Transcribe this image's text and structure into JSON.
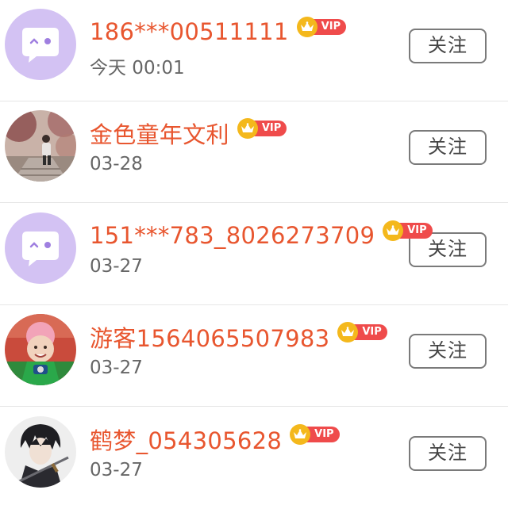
{
  "follow_label": "关注",
  "vip_label": "VIP",
  "colors": {
    "name": "#e8562f",
    "date": "#666666",
    "vip_crown": "#f4b81c",
    "vip_tag": "#ef4b4b",
    "default_avatar_bg": "#d3c2f3",
    "button_border": "#7a7a7a"
  },
  "users": [
    {
      "name": "186***00511111",
      "date": "今天 00:01",
      "avatar": "default-chat-bubble-avatar",
      "vip": true
    },
    {
      "name": "金色童年文利",
      "date": "03-28",
      "avatar": "photo-avatar-person-on-stairs",
      "vip": true
    },
    {
      "name": "151***783_8026273709",
      "date": "03-27",
      "avatar": "default-chat-bubble-avatar",
      "vip": true
    },
    {
      "name": "游客1564065507983",
      "date": "03-27",
      "avatar": "photo-avatar-child",
      "vip": true
    },
    {
      "name": "鹤梦_054305628",
      "date": "03-27",
      "avatar": "illustrated-avatar-swordsman",
      "vip": true
    }
  ]
}
